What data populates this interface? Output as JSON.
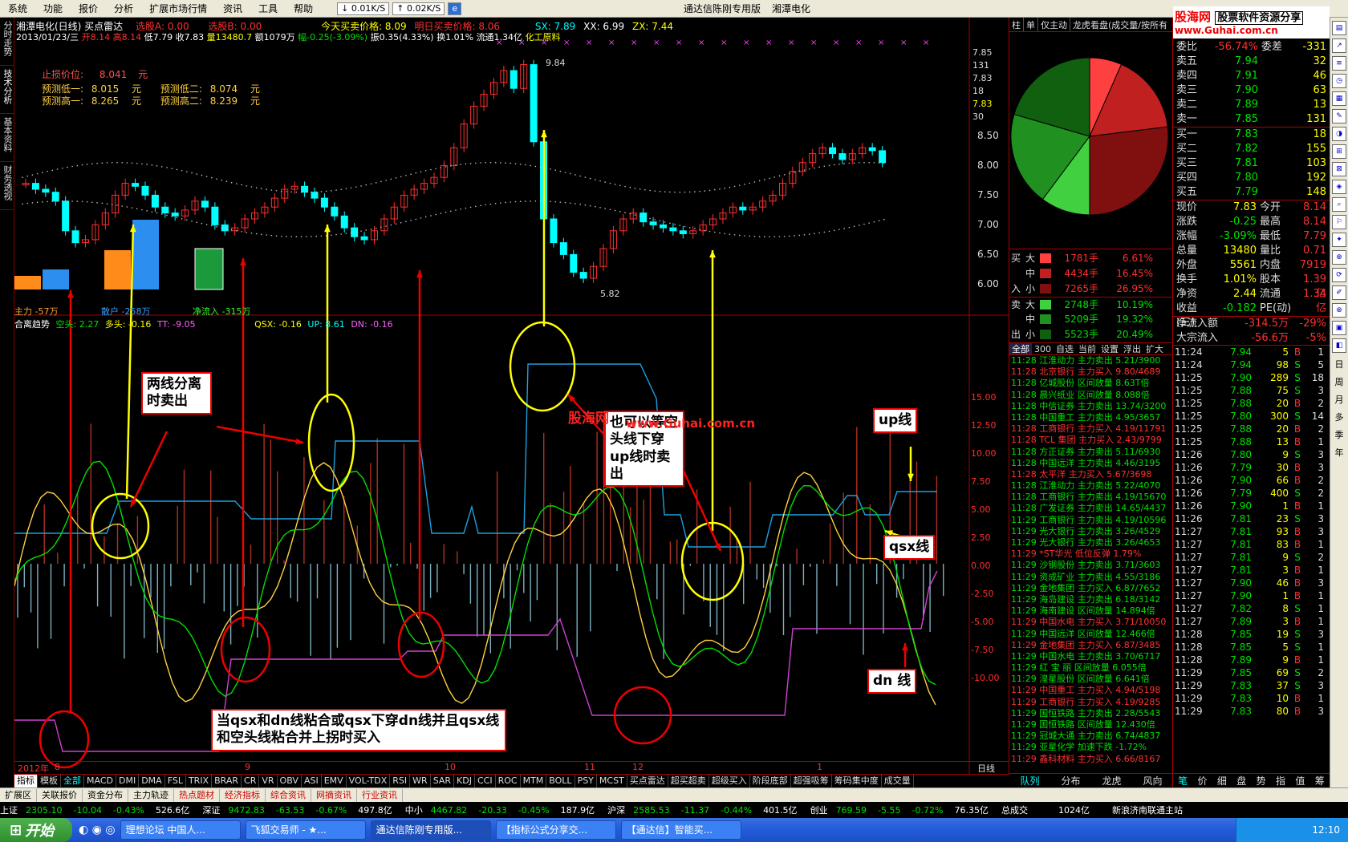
{
  "menu": {
    "items": [
      "系统",
      "功能",
      "报价",
      "分析",
      "扩展市场行情",
      "资讯",
      "工具",
      "帮助"
    ],
    "speed1": "0.01K/S",
    "speed2": "0.02K/S",
    "app_title": "通达信陈刚专用版",
    "stock_name": "湘潭电化"
  },
  "header": {
    "line1": "湘潭电化(日线) 买点雷达",
    "sel_a": "选股A: 0.00",
    "sel_b": "选股B: 0.00",
    "today": "今天买卖价格: 8.09",
    "tomorrow": "明日买卖价格: 8.06",
    "sx": "SX: 7.89",
    "xx": "XX: 6.99",
    "zx": "ZX: 7.44",
    "date": "2013/01/23/三",
    "open": "开8.14",
    "high": "高8.14",
    "low": "低7.79",
    "close": "收7.83",
    "vol": "量13480.7",
    "amt": "额1079万",
    "chg": "幅-0.25(-3.09%)",
    "amp": "振0.35(4.33%)",
    "turn": "换1.01%",
    "float": "流通1.34亿",
    "ind": "化工原料"
  },
  "stoploss": {
    "label": "止损价位:",
    "value": "8.041",
    "unit": "元"
  },
  "predict": [
    {
      "label": "预测低一:",
      "value": "8.015",
      "unit": "元"
    },
    {
      "label": "预测低二:",
      "value": "8.074",
      "unit": "元"
    },
    {
      "label": "预测高一:",
      "value": "8.265",
      "unit": "元"
    },
    {
      "label": "预测高二:",
      "value": "8.239",
      "unit": "元"
    }
  ],
  "flowbars": {
    "zhuli": "主力 -57万",
    "sanhu": "散户 -258万",
    "jingliu": "净流入 -315万"
  },
  "price_labels": {
    "high": "9.84",
    "low": "5.82",
    "b": "B"
  },
  "price_axis": [
    "7.85",
    "131",
    "7.83",
    "18",
    "7.83",
    "30",
    "8.50",
    "8.00",
    "7.50",
    "7.00",
    "6.50",
    "6.00"
  ],
  "indicator_header": {
    "name": "合离趋势",
    "kongtou": "空头: 2.27",
    "duotou": "多头: -0.16",
    "tt": "TT: -9.05",
    "qsx": "QSX: -0.16",
    "up": "UP: 8.61",
    "dn": "DN: -0.16"
  },
  "ind_axis": [
    "15.00",
    "12.50",
    "10.00",
    "7.50",
    "5.00",
    "2.50",
    "0.00",
    "-2.50",
    "-5.00",
    "-7.50",
    "-10.00"
  ],
  "time_axis": {
    "y2012": "2012年",
    "m8": "8",
    "m9": "9",
    "m10": "10",
    "m11": "11",
    "m12": "12",
    "m1": "1"
  },
  "axis_label": "日线",
  "annotations": {
    "a1": "两线分离时卖出",
    "a2": "也可以等空头线下穿up线时卖出",
    "a3": "当qsx和dn线粘合或qsx下穿dn线并且qsx线和空头线粘合并上拐时买入",
    "up": "up线",
    "qsx": "qsx线",
    "dn": "dn 线",
    "watermark1": "股海网",
    "watermark2": "www.Guhai.com.cn"
  },
  "logo": {
    "l1": "股海网",
    "l2": "股票软件资源分享",
    "l3": "www.Guhai.com.cn"
  },
  "tabs": [
    "指标",
    "模板",
    "全部",
    "MACD",
    "DMI",
    "DMA",
    "FSL",
    "TRIX",
    "BRAR",
    "CR",
    "VR",
    "OBV",
    "ASI",
    "EMV",
    "VOL-TDX",
    "RSI",
    "WR",
    "SAR",
    "KDJ",
    "CCI",
    "ROC",
    "MTM",
    "BOLL",
    "PSY",
    "MCST",
    "买点雷达",
    "超买超卖",
    "超级买入",
    "阶段底部",
    "超强吸筹",
    "筹码集中度",
    "成交量"
  ],
  "infobar": [
    "扩展区",
    "关联报价",
    "资金分布",
    "主力轨迹",
    "热点题材",
    "经济指标",
    "综合资讯",
    "网摘资讯",
    "行业资讯"
  ],
  "rp_tabs": [
    "柱",
    "单",
    "仅主动",
    "龙虎看盘(成交量/按所有"
  ],
  "order_dist": [
    {
      "side": "买",
      "size": "大",
      "vol": "1781手",
      "pct": "6.61%",
      "c": "#ff4040"
    },
    {
      "side": "",
      "size": "中",
      "vol": "4434手",
      "pct": "16.45%",
      "c": "#c02020"
    },
    {
      "side": "入",
      "size": "小",
      "vol": "7265手",
      "pct": "26.95%",
      "c": "#801010"
    },
    {
      "side": "卖",
      "size": "大",
      "vol": "2748手",
      "pct": "10.19%",
      "c": "#40d040"
    },
    {
      "side": "",
      "size": "中",
      "vol": "5209手",
      "pct": "19.32%",
      "c": "#209020"
    },
    {
      "side": "出",
      "size": "小",
      "vol": "5523手",
      "pct": "20.49%",
      "c": "#106010"
    }
  ],
  "news_tabs": [
    "全部",
    "300",
    "自选",
    "当前",
    "设置",
    "浮出",
    "扩大"
  ],
  "news": [
    [
      "11:28",
      "江淮动力",
      "主力卖出",
      "5.21/3900",
      "g"
    ],
    [
      "11:28",
      "北京银行",
      "主力买入",
      "9.80/4689",
      "r"
    ],
    [
      "11:28",
      "亿城股份",
      "区间放量",
      "8.63T倍",
      "g"
    ],
    [
      "11:28",
      "晨兴纸业",
      "区间放量",
      "8.088倍",
      "g"
    ],
    [
      "11:28",
      "中信证券",
      "主力卖出",
      "13.74/3200",
      "g"
    ],
    [
      "11:28",
      "中国重工",
      "主力卖出",
      "4.95/3657",
      "g"
    ],
    [
      "11:28",
      "工商银行",
      "主力买入",
      "4.19/11791",
      "r"
    ],
    [
      "11:28",
      "TCL 集团",
      "主力买入",
      "2.43/9799",
      "r"
    ],
    [
      "11:28",
      "方正证券",
      "主力卖出",
      "5.11/6930",
      "g"
    ],
    [
      "11:28",
      "中国远洋",
      "主力卖出",
      "4.46/3195",
      "g"
    ],
    [
      "11:28",
      "太平洋",
      "主力买入",
      "5.67/3698",
      "r"
    ],
    [
      "11:28",
      "江淮动力",
      "主力卖出",
      "5.22/4070",
      "g"
    ],
    [
      "11:28",
      "工商银行",
      "主力卖出",
      "4.19/15670",
      "g"
    ],
    [
      "11:28",
      "广发证券",
      "主力卖出",
      "14.65/4437",
      "g"
    ],
    [
      "11:29",
      "工商银行",
      "主力卖出",
      "4.19/10596",
      "g"
    ],
    [
      "11:29",
      "光大银行",
      "主力卖出",
      "3.26/4529",
      "g"
    ],
    [
      "11:29",
      "光大银行",
      "主力卖出",
      "3.26/4653",
      "g"
    ],
    [
      "11:29",
      "*ST华光",
      "低位反弹",
      "1.79%",
      "r"
    ],
    [
      "11:29",
      "沙钢股份",
      "主力卖出",
      "3.71/3603",
      "g"
    ],
    [
      "11:29",
      "资成矿业",
      "主力卖出",
      "4.55/3186",
      "g"
    ],
    [
      "11:29",
      "金地集团",
      "主力买入",
      "6.87/7652",
      "g"
    ],
    [
      "11:29",
      "海岛建设",
      "主力卖出",
      "6.18/3142",
      "g"
    ],
    [
      "11:29",
      "海南建设",
      "区间放量",
      "14.894倍",
      "g"
    ],
    [
      "11:29",
      "中国水电",
      "主力买入",
      "3.71/10050",
      "r"
    ],
    [
      "11:29",
      "中国远洋",
      "区间放量",
      "12.466倍",
      "g"
    ],
    [
      "11:29",
      "金地集团",
      "主力买入",
      "6.87/3485",
      "r"
    ],
    [
      "11:29",
      "中国水电",
      "主力卖出",
      "3.70/6717",
      "g"
    ],
    [
      "11:29",
      "红 宝 丽",
      "区间放量",
      "6.055倍",
      "g"
    ],
    [
      "11:29",
      "湟星股份",
      "区间放量",
      "6.641倍",
      "g"
    ],
    [
      "11:29",
      "中国重工",
      "主力买入",
      "4.94/5198",
      "r"
    ],
    [
      "11:29",
      "工商银行",
      "主力买入",
      "4.19/9285",
      "r"
    ],
    [
      "11:29",
      "国恒铁路",
      "主力卖出",
      "2.28/5543",
      "g"
    ],
    [
      "11:29",
      "国恒铁路",
      "区间放量",
      "12.430倍",
      "g"
    ],
    [
      "11:29",
      "冠城大通",
      "主力卖出",
      "6.74/4837",
      "g"
    ],
    [
      "11:29",
      "亚星化学",
      "加速下跌",
      "-1.72%",
      "g"
    ],
    [
      "11:29",
      "鑫科材料",
      "主力买入",
      "6.66/8167",
      "r"
    ]
  ],
  "rp_bottom_tabs": [
    "队列",
    "分布",
    "龙虎",
    "风向"
  ],
  "quote": {
    "sell": [
      {
        "l": "卖五",
        "p": "7.94",
        "v": "32"
      },
      {
        "l": "卖四",
        "p": "7.91",
        "v": "46"
      },
      {
        "l": "卖三",
        "p": "7.90",
        "v": "63"
      },
      {
        "l": "卖二",
        "p": "7.89",
        "v": "13"
      },
      {
        "l": "卖一",
        "p": "7.85",
        "v": "131"
      }
    ],
    "buy": [
      {
        "l": "买一",
        "p": "7.83",
        "v": "18"
      },
      {
        "l": "买二",
        "p": "7.82",
        "v": "155"
      },
      {
        "l": "买三",
        "p": "7.81",
        "v": "103"
      },
      {
        "l": "买四",
        "p": "7.80",
        "v": "192"
      },
      {
        "l": "买五",
        "p": "7.79",
        "v": "148"
      }
    ],
    "wb": "委比",
    "wb_v": "-56.74%",
    "wc": "委差",
    "wc_v": "-331",
    "stats": [
      [
        "现价",
        "7.83",
        "今开",
        "8.14"
      ],
      [
        "涨跌",
        "-0.25",
        "最高",
        "8.14"
      ],
      [
        "涨幅",
        "-3.09%",
        "最低",
        "7.79"
      ],
      [
        "总量",
        "13480",
        "量比",
        "0.71"
      ],
      [
        "外盘",
        "5561",
        "内盘",
        "7919"
      ],
      [
        "换手",
        "1.01%",
        "股本",
        "1.39亿"
      ],
      [
        "净资",
        "2.44",
        "流通",
        "1.34亿"
      ],
      [
        "收益(三)",
        "-0.182",
        "PE(动)",
        "-"
      ]
    ],
    "flow1": "净流入额",
    "flow1_v": "-314.5万",
    "flow1_p": "-29%",
    "flow2": "大宗流入",
    "flow2_v": "-56.6万",
    "flow2_p": "-5%"
  },
  "trades": [
    [
      "11:24",
      "7.94",
      "5",
      "B",
      "1"
    ],
    [
      "11:24",
      "7.94",
      "98",
      "S",
      "5"
    ],
    [
      "11:25",
      "7.90",
      "289",
      "S",
      "18"
    ],
    [
      "11:25",
      "7.88",
      "75",
      "S",
      "3"
    ],
    [
      "11:25",
      "7.88",
      "20",
      "B",
      "2"
    ],
    [
      "11:25",
      "7.80",
      "300",
      "S",
      "14"
    ],
    [
      "11:25",
      "7.88",
      "20",
      "B",
      "2"
    ],
    [
      "11:25",
      "7.88",
      "13",
      "B",
      "1"
    ],
    [
      "11:26",
      "7.80",
      "9",
      "S",
      "3"
    ],
    [
      "11:26",
      "7.79",
      "30",
      "B",
      "3"
    ],
    [
      "11:26",
      "7.90",
      "66",
      "B",
      "2"
    ],
    [
      "11:26",
      "7.79",
      "400",
      "S",
      "2"
    ],
    [
      "11:26",
      "7.90",
      "1",
      "B",
      "1"
    ],
    [
      "11:26",
      "7.81",
      "23",
      "S",
      "3"
    ],
    [
      "11:27",
      "7.81",
      "93",
      "B",
      "3"
    ],
    [
      "11:27",
      "7.81",
      "83",
      "B",
      "1"
    ],
    [
      "11:27",
      "7.81",
      "9",
      "S",
      "2"
    ],
    [
      "11:27",
      "7.81",
      "3",
      "B",
      "1"
    ],
    [
      "11:27",
      "7.90",
      "46",
      "B",
      "3"
    ],
    [
      "11:27",
      "7.90",
      "1",
      "B",
      "1"
    ],
    [
      "11:27",
      "7.82",
      "8",
      "S",
      "1"
    ],
    [
      "11:27",
      "7.89",
      "3",
      "B",
      "1"
    ],
    [
      "11:28",
      "7.85",
      "19",
      "S",
      "3"
    ],
    [
      "11:28",
      "7.85",
      "5",
      "S",
      "1"
    ],
    [
      "11:28",
      "7.89",
      "9",
      "B",
      "1"
    ],
    [
      "11:29",
      "7.85",
      "69",
      "S",
      "2"
    ],
    [
      "11:29",
      "7.83",
      "37",
      "S",
      "3"
    ],
    [
      "11:29",
      "7.83",
      "10",
      "B",
      "1"
    ],
    [
      "11:29",
      "7.83",
      "80",
      "B",
      "3"
    ]
  ],
  "qp_bottom_tabs": [
    "笔",
    "价",
    "细",
    "盘",
    "势",
    "指",
    "值",
    "筹"
  ],
  "right_icon_labels": [
    "日",
    "周",
    "月",
    "多",
    "季",
    "年"
  ],
  "index_bar": [
    {
      "n": "上证",
      "v": "2305.10",
      "c": "-10.04",
      "p": "-0.43%",
      "a": "526.6亿"
    },
    {
      "n": "深证",
      "v": "9472.83",
      "c": "-63.53",
      "p": "-0.67%",
      "a": "497.8亿"
    },
    {
      "n": "中小",
      "v": "4467.82",
      "c": "-20.33",
      "p": "-0.45%",
      "a": "187.9亿"
    },
    {
      "n": "沪深",
      "v": "2585.53",
      "c": "-11.37",
      "p": "-0.44%",
      "a": "401.5亿"
    },
    {
      "n": "创业",
      "v": "769.59",
      "c": "-5.55",
      "p": "-0.72%",
      "a": "76.35亿"
    }
  ],
  "total_label": "总成交",
  "total_v": "1024亿",
  "server": "新浪济南联通主站",
  "taskbar": {
    "start": "开始",
    "items": [
      "理想论坛 中国人...",
      "飞狐交易师 - ★...",
      "通达信陈刚专用版...",
      "【指标公式分享交...",
      "【通达信】智能买..."
    ],
    "clock": "12:10"
  },
  "left_strip": [
    "分时走势",
    "技术分析",
    "基本资料",
    "财务透视"
  ],
  "colors": {
    "up": "#ff3030",
    "down": "#00ffff",
    "kong": "#00e000",
    "duo": "#ffd040",
    "qsx": "#ffd040",
    "upline": "#1ea0e0",
    "dnline": "#d040d0"
  }
}
